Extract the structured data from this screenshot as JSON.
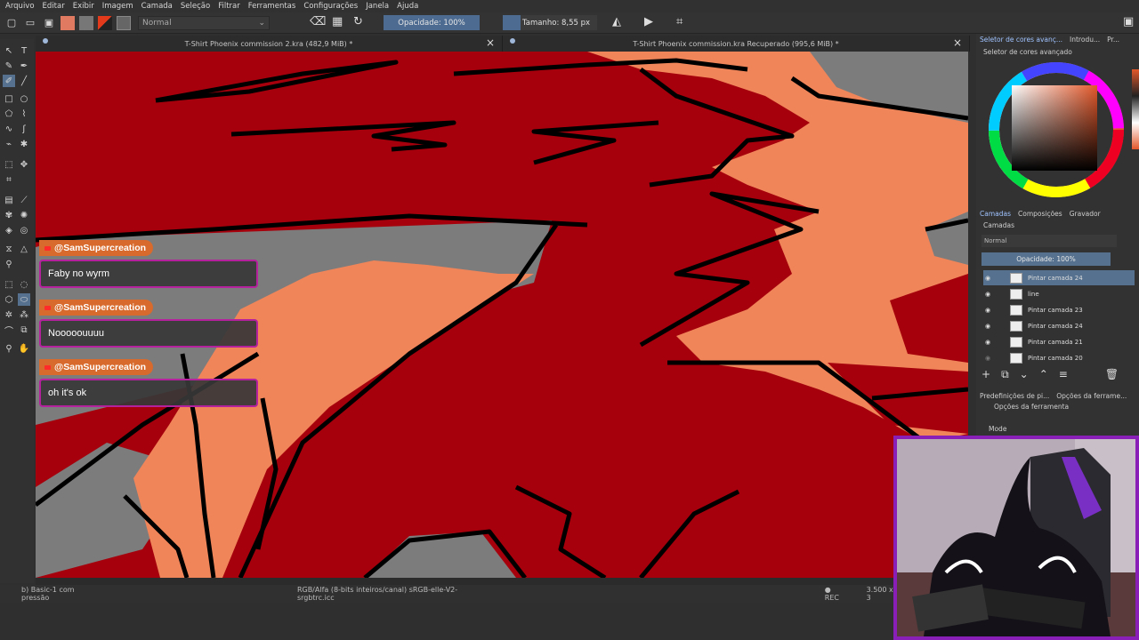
{
  "menu": [
    "Arquivo",
    "Editar",
    "Exibir",
    "Imagem",
    "Camada",
    "Seleção",
    "Filtrar",
    "Ferramentas",
    "Configurações",
    "Janela",
    "Ajuda"
  ],
  "toolbar": {
    "blend_mode": "Normal",
    "opacity_label": "Opacidade: 100%",
    "size_label": "Tamanho: 8,55 px"
  },
  "tabs": [
    {
      "title": "T-Shirt Phoenix commission 2.kra (482,9 MiB) *"
    },
    {
      "title": "T-Shirt Phoenix commission.kra Recuperado (995,6 MiB) *"
    }
  ],
  "dock": {
    "top_tabs": [
      "Seletor de cores avanç...",
      "Introdu...",
      "Pr..."
    ],
    "color_selector_title": "Seletor de cores avançado",
    "layers_tabs": [
      "Camadas",
      "Composições",
      "Gravador"
    ],
    "layers_title": "Camadas",
    "blend": "Normal",
    "opacity": "Opacidade:  100%",
    "layers": [
      {
        "name": "Pintar camada 24",
        "selected": true
      },
      {
        "name": "line",
        "selected": false
      },
      {
        "name": "Pintar camada 23",
        "selected": false
      },
      {
        "name": "Pintar camada 24",
        "selected": false
      },
      {
        "name": "Pintar camada 21",
        "selected": false
      },
      {
        "name": "Pintar camada 20",
        "selected": false
      }
    ],
    "bottom_tabs": [
      "Predefinições de pi...",
      "Opções da ferrame..."
    ],
    "tool_options_title": "Opções da ferramenta",
    "mode_label": "Mode"
  },
  "status": {
    "brush": "b) Basic-1 com pressão",
    "color_space": "RGB/Alfa (8-bits inteiros/canal)  sRGB-elle-V2-srgbtrc.icc",
    "rec": "● REC",
    "size": "3.500 x 3"
  },
  "chat": [
    {
      "user": "@SamSupercreation",
      "message": "Faby no wyrm"
    },
    {
      "user": "@SamSupercreation",
      "message": "Nooooouuuu"
    },
    {
      "user": "@SamSupercreation",
      "message": "oh it's ok"
    }
  ],
  "colors": {
    "canvas_red": "#a5000c",
    "canvas_orange": "#f0855a",
    "canvas_gray": "#7c7c7c",
    "chat_accent": "#b5219d",
    "name_badge": "#d76a2c",
    "webcam_border": "#8a1fb8"
  }
}
